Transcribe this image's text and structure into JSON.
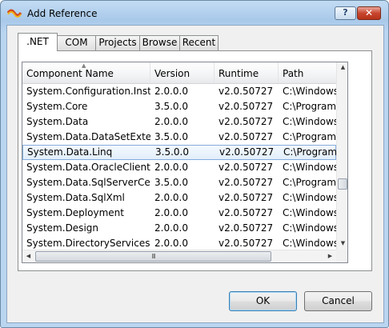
{
  "window": {
    "title": "Add Reference",
    "help_label": "?",
    "close_label": "✕"
  },
  "tabs": [
    {
      "label": ".NET",
      "active": true
    },
    {
      "label": "COM",
      "active": false
    },
    {
      "label": "Projects",
      "active": false
    },
    {
      "label": "Browse",
      "active": false
    },
    {
      "label": "Recent",
      "active": false
    }
  ],
  "table": {
    "columns": [
      "Component Name",
      "Version",
      "Runtime",
      "Path"
    ],
    "sorted_column": "Component Name",
    "selected_row": "System.Data.Linq",
    "rows": [
      {
        "name": "System.Configuration.Install",
        "version": "2.0.0.0",
        "runtime": "v2.0.50727",
        "path": "C:\\Windows\\"
      },
      {
        "name": "System.Core",
        "version": "3.5.0.0",
        "runtime": "v2.0.50727",
        "path": "C:\\Program"
      },
      {
        "name": "System.Data",
        "version": "2.0.0.0",
        "runtime": "v2.0.50727",
        "path": "C:\\Windows\\"
      },
      {
        "name": "System.Data.DataSetExtens...",
        "version": "3.5.0.0",
        "runtime": "v2.0.50727",
        "path": "C:\\Program"
      },
      {
        "name": "System.Data.Linq",
        "version": "3.5.0.0",
        "runtime": "v2.0.50727",
        "path": "C:\\Program"
      },
      {
        "name": "System.Data.OracleClient",
        "version": "2.0.0.0",
        "runtime": "v2.0.50727",
        "path": "C:\\Windows\\"
      },
      {
        "name": "System.Data.SqlServerCe",
        "version": "3.5.0.0",
        "runtime": "v2.0.50727",
        "path": "C:\\Program"
      },
      {
        "name": "System.Data.SqlXml",
        "version": "2.0.0.0",
        "runtime": "v2.0.50727",
        "path": "C:\\Windows\\"
      },
      {
        "name": "System.Deployment",
        "version": "2.0.0.0",
        "runtime": "v2.0.50727",
        "path": "C:\\Windows\\"
      },
      {
        "name": "System.Design",
        "version": "2.0.0.0",
        "runtime": "v2.0.50727",
        "path": "C:\\Windows\\"
      },
      {
        "name": "System.DirectoryServices",
        "version": "2.0.0.0",
        "runtime": "v2.0.50727",
        "path": "C:\\Windows\\"
      }
    ]
  },
  "buttons": {
    "ok": "OK",
    "cancel": "Cancel"
  }
}
